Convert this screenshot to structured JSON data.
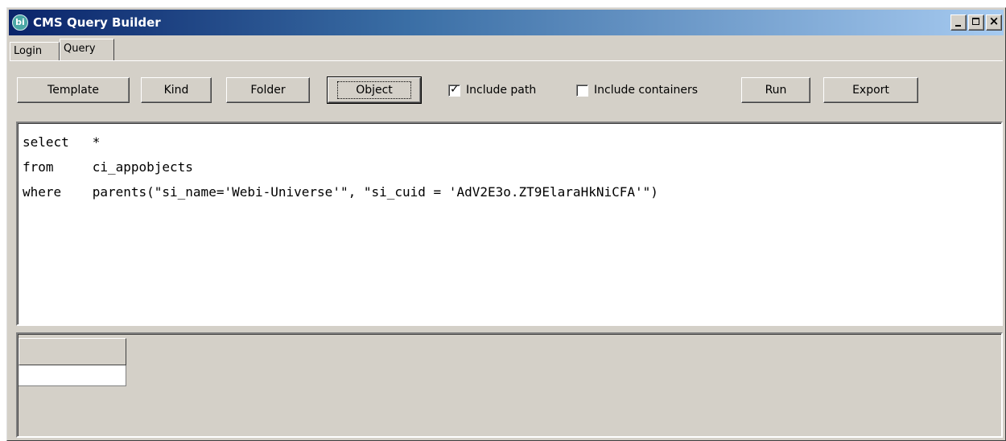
{
  "window": {
    "title": "CMS Query Builder",
    "app_icon_text": "bi",
    "controls": {
      "minimize": "minimize",
      "maximize": "maximize",
      "close": "×"
    }
  },
  "tabs": [
    {
      "label": "Login",
      "active": false
    },
    {
      "label": "Query",
      "active": true
    }
  ],
  "toolbar": {
    "template_label": "Template",
    "kind_label": "Kind",
    "folder_label": "Folder",
    "object_label": "Object",
    "include_path_label": "Include path",
    "include_path_checked": true,
    "include_containers_label": "Include containers",
    "include_containers_checked": false,
    "run_label": "Run",
    "export_label": "Export"
  },
  "editor": {
    "query": "select   *\nfrom     ci_appobjects\nwhere    parents(\"si_name='Webi-Universe'\", \"si_cuid = 'AdV2E3o.ZT9ElaraHkNiCFA'\")"
  },
  "results": {
    "header_cell": "",
    "first_cell": ""
  },
  "colors": {
    "face": "#d4d0c8",
    "title_start": "#0a246a",
    "title_end": "#a6caf0",
    "app_icon": "#4aa7a5"
  }
}
